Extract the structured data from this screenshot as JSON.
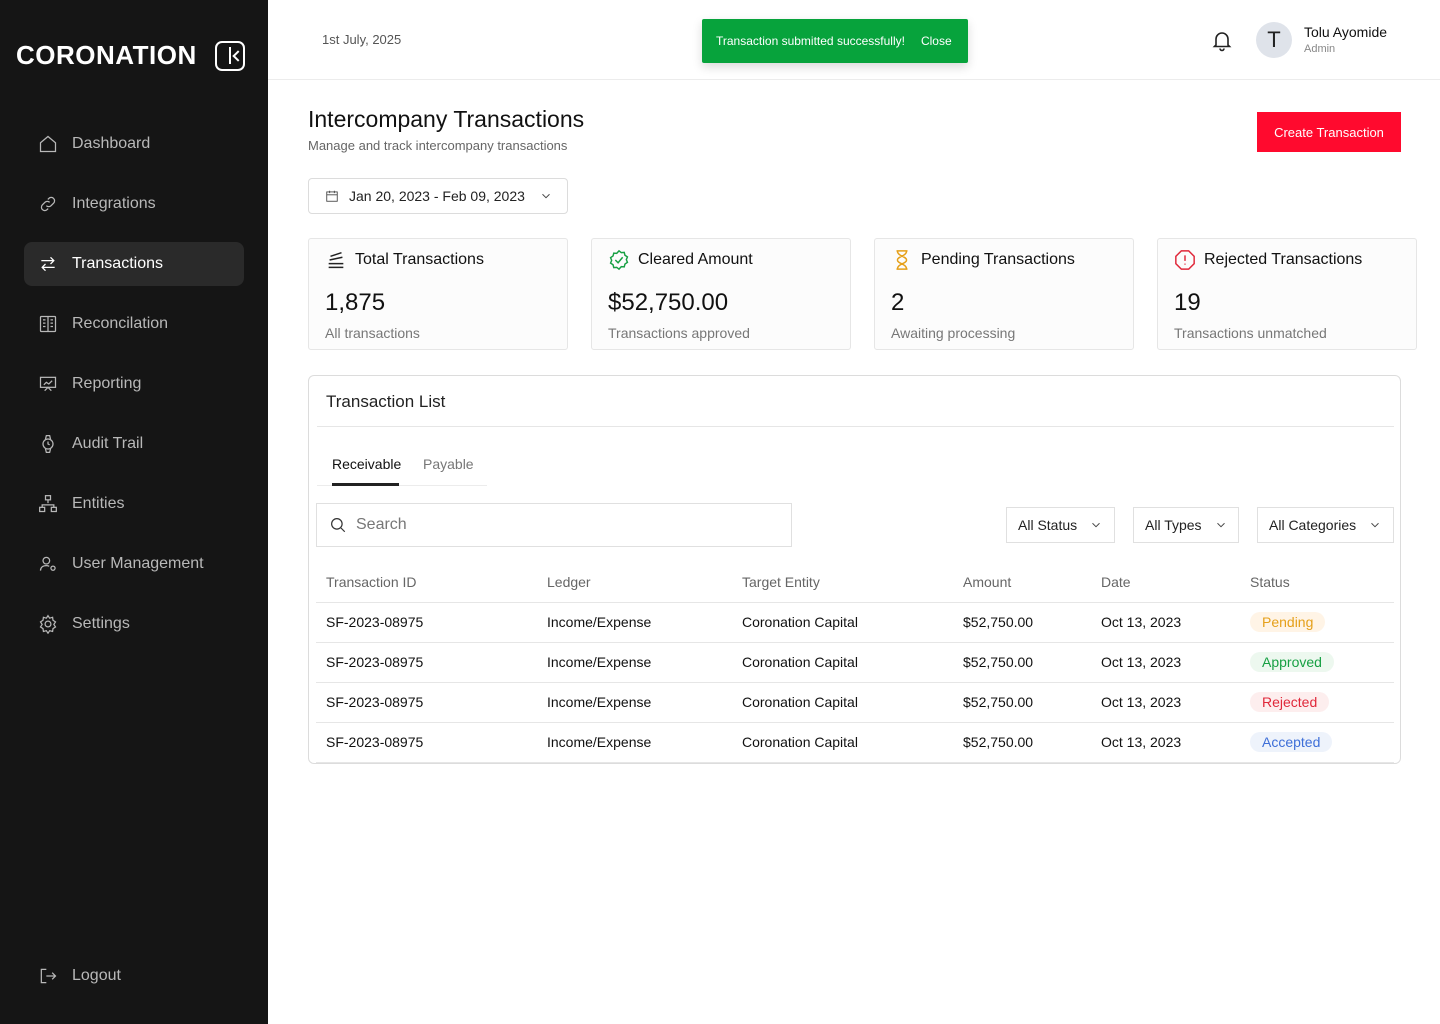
{
  "app": {
    "logo_text": "CORONATION"
  },
  "sidebar": {
    "items": [
      {
        "label": "Dashboard",
        "icon": "home-icon",
        "active": false
      },
      {
        "label": "Integrations",
        "icon": "link-icon",
        "active": false
      },
      {
        "label": "Transactions",
        "icon": "arrows-swap-icon",
        "active": true
      },
      {
        "label": "Reconcilation",
        "icon": "ledger-icon",
        "active": false
      },
      {
        "label": "Reporting",
        "icon": "presentation-chart-icon",
        "active": false
      },
      {
        "label": "Audit Trail",
        "icon": "watch-icon",
        "active": false
      },
      {
        "label": "Entities",
        "icon": "hierarchy-icon",
        "active": false
      },
      {
        "label": "User Management",
        "icon": "user-gear-icon",
        "active": false
      },
      {
        "label": "Settings",
        "icon": "gear-icon",
        "active": false
      }
    ],
    "logout_label": "Logout"
  },
  "header": {
    "date": "1st July, 2025",
    "toast": {
      "message": "Transaction submitted successfully!",
      "close_label": "Close",
      "color": "#07a33c"
    },
    "user": {
      "initial": "T",
      "name": "Tolu Ayomide",
      "role": "Admin"
    }
  },
  "main": {
    "title": "Intercompany Transactions",
    "subtitle": "Manage and track intercompany transactions",
    "create_button": "Create Transaction",
    "accent_color": "#ff0a2e",
    "date_range": "Jan 20, 2023 - Feb 09, 2023",
    "cards": [
      {
        "title": "Total Transactions",
        "value": "1,875",
        "sub": "All transactions",
        "icon": "stack-icon",
        "icon_color": "#222222"
      },
      {
        "title": "Cleared Amount",
        "value": "$52,750.00",
        "sub": "Transactions approved",
        "icon": "verified-badge-icon",
        "icon_color": "#17a043"
      },
      {
        "title": "Pending Transactions",
        "value": "2",
        "sub": "Awaiting processing",
        "icon": "hourglass-icon",
        "icon_color": "#e5a01a"
      },
      {
        "title": "Rejected Transactions",
        "value": "19",
        "sub": "Transactions unmatched",
        "icon": "alert-octagon-icon",
        "icon_color": "#e0283a"
      }
    ]
  },
  "transaction_list": {
    "title": "Transaction List",
    "tabs": [
      {
        "label": "Receivable",
        "active": true
      },
      {
        "label": "Payable",
        "active": false
      }
    ],
    "search_placeholder": "Search",
    "filters": [
      "All Status",
      "All Types",
      "All Categories"
    ],
    "columns": [
      "Transaction ID",
      "Ledger",
      "Target Entity",
      "Amount",
      "Date",
      "Status"
    ],
    "rows": [
      {
        "id": "SF-2023-08975",
        "ledger": "Income/Expense",
        "entity": "Coronation Capital",
        "amount": "$52,750.00",
        "date": "Oct 13, 2023",
        "status": "Pending"
      },
      {
        "id": "SF-2023-08975",
        "ledger": "Income/Expense",
        "entity": "Coronation Capital",
        "amount": "$52,750.00",
        "date": "Oct 13, 2023",
        "status": "Approved"
      },
      {
        "id": "SF-2023-08975",
        "ledger": "Income/Expense",
        "entity": "Coronation Capital",
        "amount": "$52,750.00",
        "date": "Oct 13, 2023",
        "status": "Rejected"
      },
      {
        "id": "SF-2023-08975",
        "ledger": "Income/Expense",
        "entity": "Coronation Capital",
        "amount": "$52,750.00",
        "date": "Oct 13, 2023",
        "status": "Accepted"
      }
    ]
  }
}
